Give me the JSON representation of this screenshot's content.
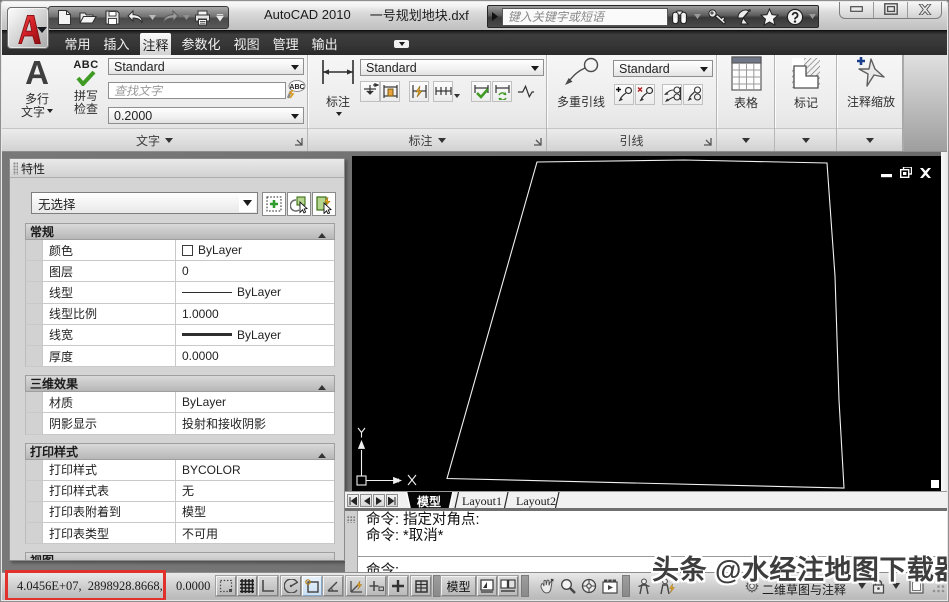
{
  "window": {
    "app_title": "AutoCAD 2010",
    "doc_title": "一号规划地块.dxf"
  },
  "qat": {
    "icons": [
      "new",
      "open",
      "save",
      "undo",
      "redo",
      "plot",
      "customize"
    ]
  },
  "infocenter": {
    "placeholder": "键入关键字或短语",
    "icons": [
      "search",
      "key",
      "communication",
      "favorites",
      "help"
    ]
  },
  "ribbon": {
    "tabs": [
      {
        "label": "常用",
        "active": false
      },
      {
        "label": "插入",
        "active": false
      },
      {
        "label": "注释",
        "active": true
      },
      {
        "label": "参数化",
        "active": false
      },
      {
        "label": "视图",
        "active": false
      },
      {
        "label": "管理",
        "active": false
      },
      {
        "label": "输出",
        "active": false
      }
    ],
    "text_panel": {
      "title": "文字",
      "mtext_label_1": "多行",
      "mtext_label_2": "文字",
      "mtext_icon": "A",
      "spell_label_1": "拼写",
      "spell_label_2": "检查",
      "spell_icon": "ABC",
      "style_combo": "Standard",
      "find_placeholder": "查找文字",
      "height_combo": "0.2000"
    },
    "dim_panel": {
      "title": "标注",
      "big_label": "标注",
      "style_combo": "Standard"
    },
    "leader_panel": {
      "title": "引线",
      "big_label": "多重引线",
      "style_combo": "Standard"
    },
    "table_panel": {
      "title": "表格"
    },
    "markup_panel": {
      "title": "标记"
    },
    "annoscale_panel": {
      "title": "注释缩放"
    }
  },
  "palette": {
    "title": "特性",
    "selector": "无选择",
    "sections": [
      {
        "title": "常规",
        "rows": [
          {
            "label": "颜色",
            "value": "ByLayer"
          },
          {
            "label": "图层",
            "value": "0"
          },
          {
            "label": "线型",
            "value": "ByLayer"
          },
          {
            "label": "线型比例",
            "value": "1.0000"
          },
          {
            "label": "线宽",
            "value": "ByLayer"
          },
          {
            "label": "厚度",
            "value": "0.0000"
          }
        ]
      },
      {
        "title": "三维效果",
        "rows": [
          {
            "label": "材质",
            "value": "ByLayer"
          },
          {
            "label": "阴影显示",
            "value": "投射和接收阴影"
          }
        ]
      },
      {
        "title": "打印样式",
        "rows": [
          {
            "label": "打印样式",
            "value": "BYCOLOR"
          },
          {
            "label": "打印样式表",
            "value": "无"
          },
          {
            "label": "打印表附着到",
            "value": "模型"
          },
          {
            "label": "打印表类型",
            "value": "不可用"
          }
        ]
      },
      {
        "title": "视图",
        "rows": []
      }
    ]
  },
  "viewport": {
    "ucs_x_label": "X",
    "ucs_y_label": "Y"
  },
  "layout_tabs": {
    "model": "模型",
    "layout1": "Layout1",
    "layout2": "Layout2"
  },
  "command": {
    "line1": "命令: 指定对角点:",
    "line2": "命令: *取消*",
    "prompt": "命令:"
  },
  "statusbar": {
    "coords_xy": "4.0456E+07, 2898928.8668,",
    "coord_z": "0.0000",
    "model_label": "模型",
    "workspace_label": "二维草图与注释",
    "toggles": [
      "snap",
      "grid",
      "ortho",
      "polar",
      "osnap",
      "otrack",
      "ducs",
      "dyn",
      "lwt",
      "qp"
    ]
  },
  "watermark": "头条 @水经注地图下载器",
  "colors": {
    "accent_red_box": "#e0312d",
    "canvas_bg": "#000000",
    "polyline": "#f2f2f2",
    "tab_bar": "#2e2e2e",
    "osnap_active_bg": "#cbe0f3"
  }
}
